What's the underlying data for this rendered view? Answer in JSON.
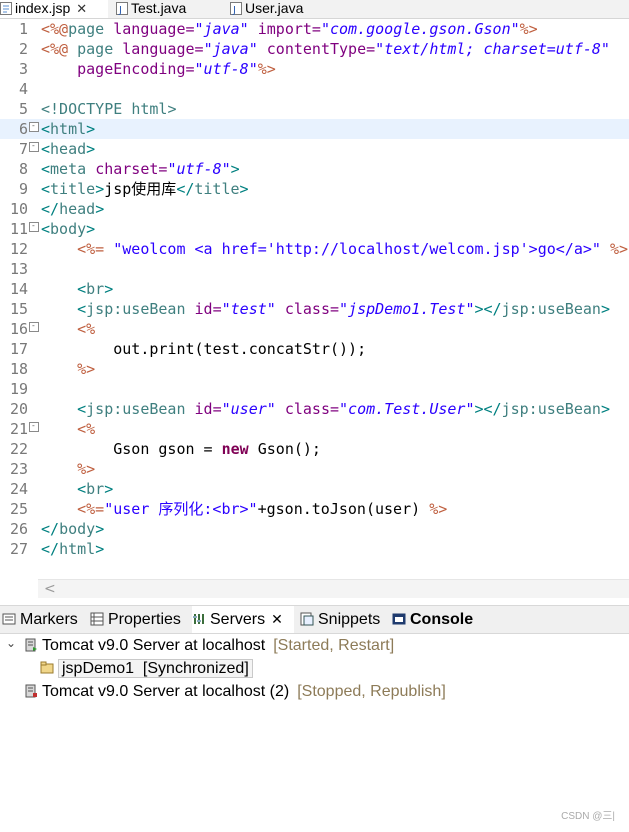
{
  "editor_tabs": [
    {
      "label": "index.jsp",
      "active": true,
      "icon": "jsp-file-icon"
    },
    {
      "label": "Test.java",
      "active": false,
      "icon": "java-file-icon"
    },
    {
      "label": "User.java",
      "active": false,
      "icon": "java-file-icon"
    }
  ],
  "close_glyph": "✕",
  "code": {
    "lines": [
      {
        "n": "1",
        "fold": false
      },
      {
        "n": "2",
        "fold": false
      },
      {
        "n": "3",
        "fold": false
      },
      {
        "n": "4",
        "fold": false
      },
      {
        "n": "5",
        "fold": false
      },
      {
        "n": "6",
        "fold": true,
        "current": true
      },
      {
        "n": "7",
        "fold": true
      },
      {
        "n": "8",
        "fold": false
      },
      {
        "n": "9",
        "fold": false
      },
      {
        "n": "10",
        "fold": false
      },
      {
        "n": "11",
        "fold": true
      },
      {
        "n": "12",
        "fold": false
      },
      {
        "n": "13",
        "fold": false
      },
      {
        "n": "14",
        "fold": false
      },
      {
        "n": "15",
        "fold": false
      },
      {
        "n": "16",
        "fold": true
      },
      {
        "n": "17",
        "fold": false
      },
      {
        "n": "18",
        "fold": false
      },
      {
        "n": "19",
        "fold": false
      },
      {
        "n": "20",
        "fold": false
      },
      {
        "n": "21",
        "fold": true
      },
      {
        "n": "22",
        "fold": false
      },
      {
        "n": "23",
        "fold": false
      },
      {
        "n": "24",
        "fold": false
      },
      {
        "n": "25",
        "fold": false
      },
      {
        "n": "26",
        "fold": false
      },
      {
        "n": "27",
        "fold": false
      }
    ],
    "tokens": {
      "l1": [
        "<%@",
        "page ",
        "language=",
        "\"java\"",
        " import=",
        "\"com.google.gson.Gson\"",
        "%>"
      ],
      "l2": [
        "<%@",
        " page ",
        "language=",
        "\"java\"",
        " contentType=",
        "\"text/html; charset=utf-8\""
      ],
      "l3": [
        "    pageEncoding=",
        "\"utf-8\"",
        "%>"
      ],
      "l5": [
        "<!DOCTYPE ",
        "html",
        ">"
      ],
      "l6": [
        "<",
        "html",
        ">"
      ],
      "l7": [
        "<",
        "head",
        ">"
      ],
      "l8": [
        "<",
        "meta ",
        "charset=",
        "\"utf-8\"",
        ">"
      ],
      "l9": [
        "<",
        "title",
        ">",
        "jsp使用库",
        "</",
        "title",
        ">"
      ],
      "l10": [
        "</",
        "head",
        ">"
      ],
      "l11": [
        "<",
        "body",
        ">"
      ],
      "l12": [
        "    ",
        "<%=",
        " \"weolcom <a href='http://localhost/welcom.jsp'>go</a>\" ",
        "%>"
      ],
      "l14": [
        "    ",
        "<",
        "br",
        ">"
      ],
      "l15": [
        "    ",
        "<",
        "jsp:useBean ",
        "id=",
        "\"test\"",
        " class=",
        "\"jspDemo1.Test\"",
        "></",
        "jsp:useBean",
        ">"
      ],
      "l16": [
        "    ",
        "<%"
      ],
      "l17": [
        "        out.print(test.concatStr());"
      ],
      "l18": [
        "    ",
        "%>"
      ],
      "l20": [
        "    ",
        "<",
        "jsp:useBean ",
        "id=",
        "\"user\"",
        " class=",
        "\"com.Test.User\"",
        "></",
        "jsp:useBean",
        ">"
      ],
      "l21": [
        "    ",
        "<%"
      ],
      "l22": [
        "        Gson gson = ",
        "new",
        " Gson();"
      ],
      "l23": [
        "    ",
        "%>"
      ],
      "l24": [
        "    ",
        "<",
        "br",
        ">"
      ],
      "l25": [
        "    ",
        "<%=",
        "\"user 序列化:<br>\"",
        "+gson.toJson(user) ",
        "%>"
      ],
      "l26": [
        "</",
        "body",
        ">"
      ],
      "l27": [
        "</",
        "html",
        ">"
      ]
    }
  },
  "scroll_left_glyph": "<",
  "panel_tabs": [
    {
      "label": "Markers",
      "icon": "markers-icon",
      "active": false
    },
    {
      "label": "Properties",
      "icon": "properties-icon",
      "active": false
    },
    {
      "label": "Servers",
      "icon": "servers-icon",
      "active": true
    },
    {
      "label": "Snippets",
      "icon": "snippets-icon",
      "active": false
    },
    {
      "label": "Console",
      "icon": "console-icon",
      "active": false
    }
  ],
  "servers": [
    {
      "name": "Tomcat v9.0 Server at localhost",
      "state": "[Started, Restart]",
      "expanded": true,
      "children": [
        {
          "name": "jspDemo1",
          "state": "[Synchronized]"
        }
      ]
    },
    {
      "name": "Tomcat v9.0 Server at localhost (2)",
      "state": "[Stopped, Republish]",
      "expanded": false
    }
  ],
  "watermark": "CSDN @三|",
  "colors": {
    "delimiter": "#bf5f3f",
    "tag": "#3f7f7f",
    "attr": "#7f007f",
    "string": "#2a00ff",
    "keyword": "#7f0055",
    "server_state": "#8d7b58"
  }
}
